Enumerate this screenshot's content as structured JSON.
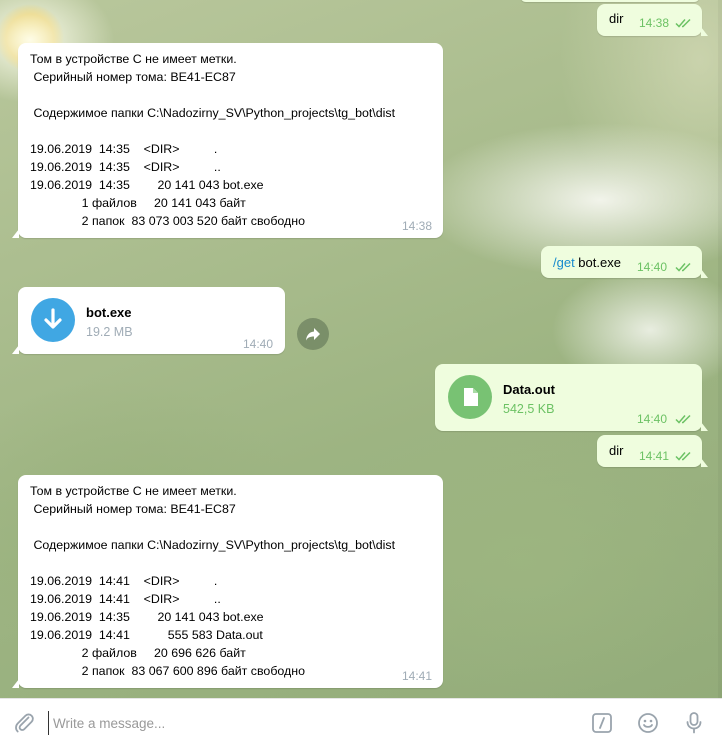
{
  "colors": {
    "accent": "#168acd",
    "incoming_bg": "#ffffff",
    "outgoing_bg": "#effdde",
    "time_outgoing": "#6cc264",
    "time_incoming": "#a0acb6",
    "file_in_icon": "#40a7e3",
    "file_out_icon": "#78c273"
  },
  "messages": {
    "m1": {
      "text": "dir",
      "time": "14:38",
      "status": "read"
    },
    "m2": {
      "text": "Том в устройстве C не имеет метки.\n Серийный номер тома: BE41-EC87\n\n Содержимое папки C:\\Nadozirny_SV\\Python_projects\\tg_bot\\dist\n\n19.06.2019  14:35    <DIR>          .\n19.06.2019  14:35    <DIR>          ..\n19.06.2019  14:35        20 141 043 bot.exe\n               1 файлов     20 141 043 байт\n               2 папок  83 073 003 520 байт свободно",
      "time": "14:38"
    },
    "m3": {
      "command": "/get",
      "arg": " bot.exe",
      "time": "14:40",
      "status": "read"
    },
    "m4": {
      "file_name": "bot.exe",
      "file_size": "19.2 MB",
      "time": "14:40",
      "icon": "download-icon"
    },
    "m5": {
      "file_name": "Data.out",
      "file_size": "542,5 KB",
      "time": "14:40",
      "status": "read",
      "icon": "document-icon"
    },
    "m6": {
      "text": "dir",
      "time": "14:41",
      "status": "read"
    },
    "m7": {
      "text": "Том в устройстве C не имеет метки.\n Серийный номер тома: BE41-EC87\n\n Содержимое папки C:\\Nadozirny_SV\\Python_projects\\tg_bot\\dist\n\n19.06.2019  14:41    <DIR>          .\n19.06.2019  14:41    <DIR>          ..\n19.06.2019  14:35        20 141 043 bot.exe\n19.06.2019  14:41           555 583 Data.out\n               2 файлов     20 696 626 байт\n               2 папок  83 067 600 896 байт свободно",
      "time": "14:41"
    }
  },
  "input": {
    "placeholder": "Write a message...",
    "value": ""
  }
}
